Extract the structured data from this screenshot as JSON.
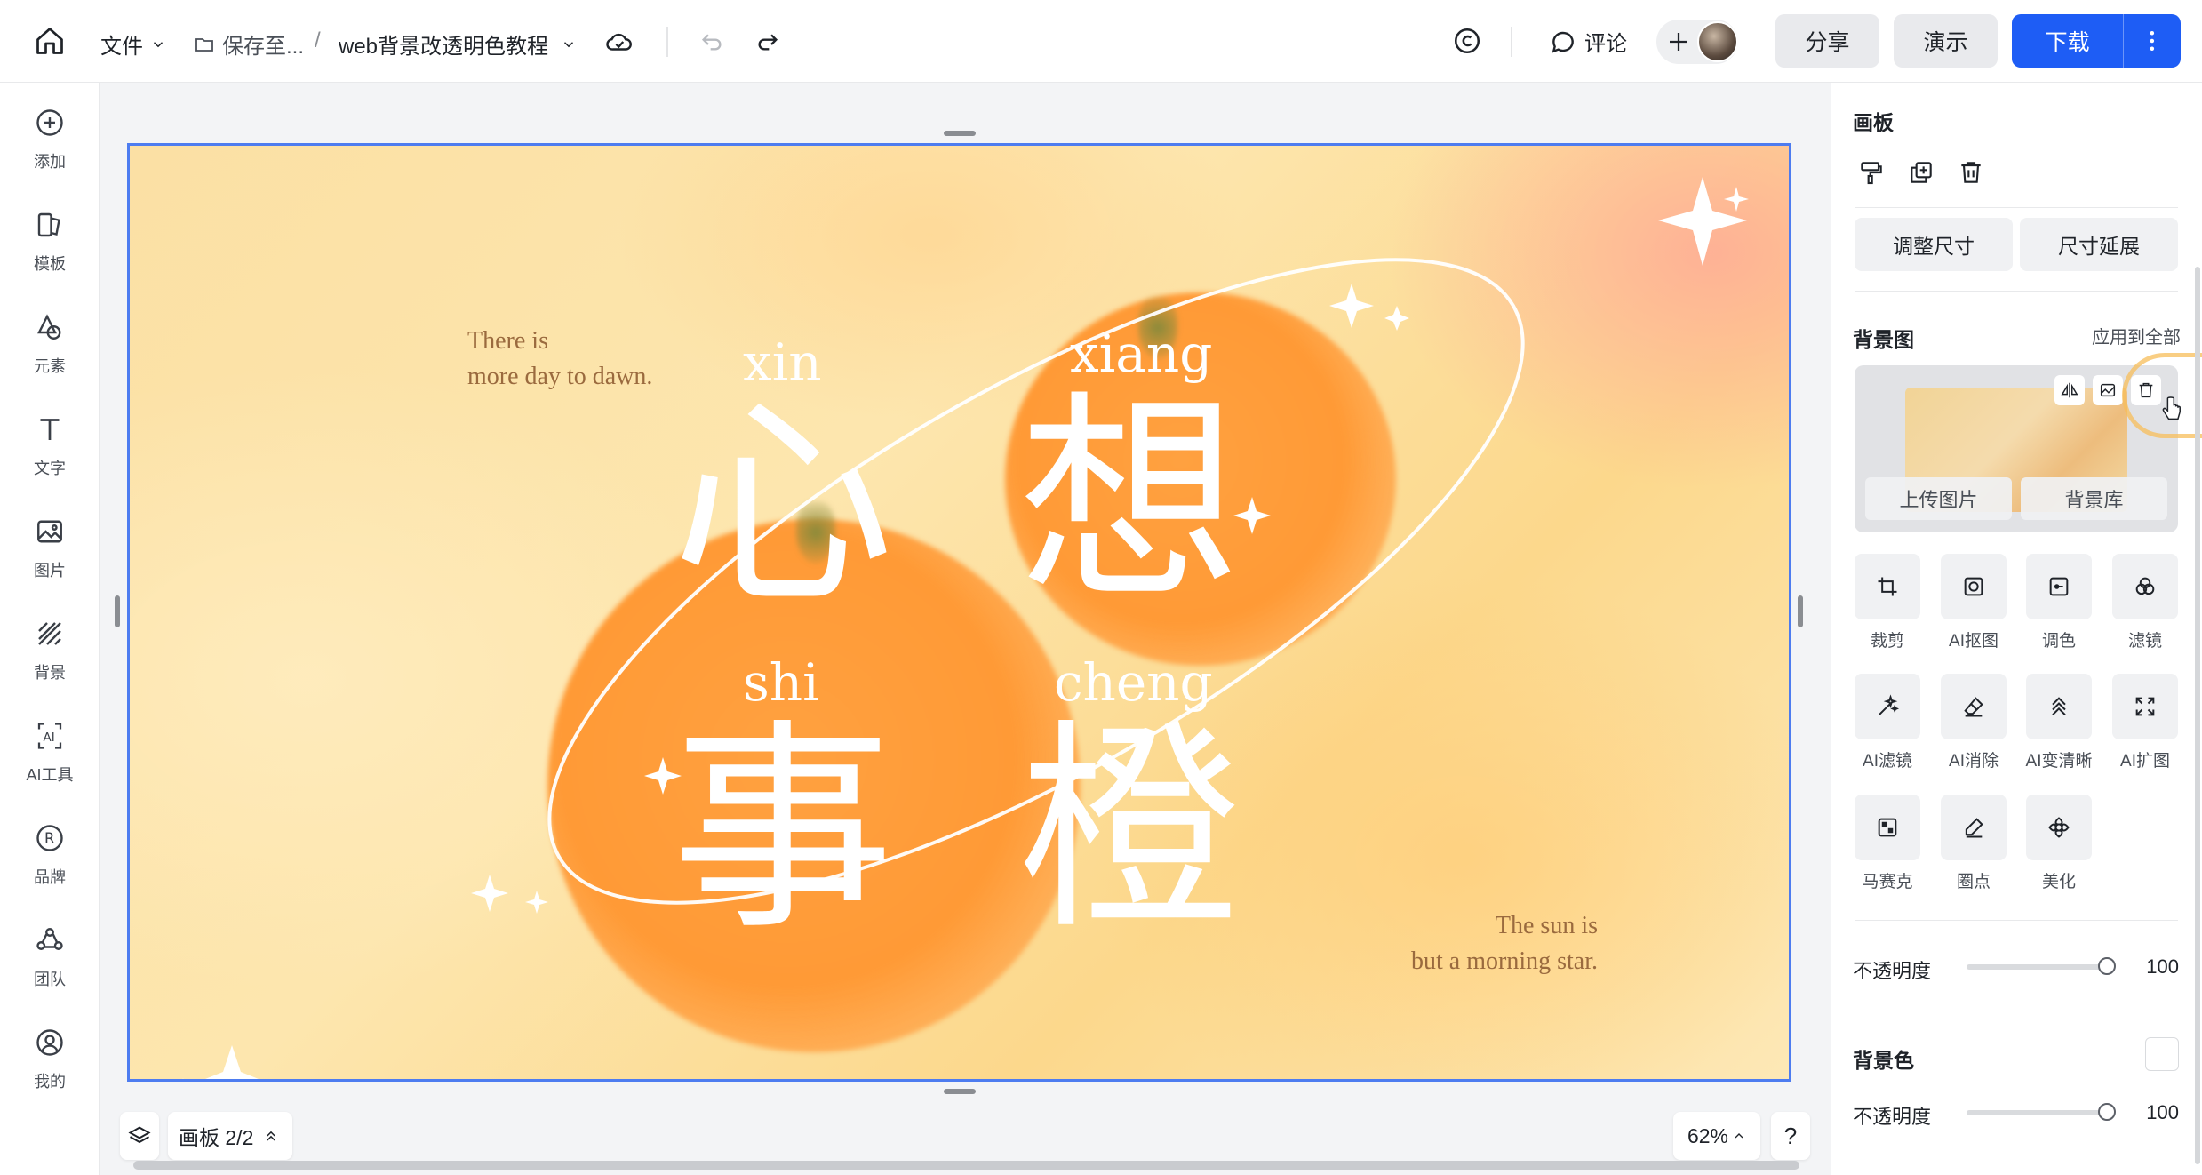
{
  "topbar": {
    "file_label": "文件",
    "save_path": "保存至...",
    "separator": "/",
    "doc_title": "web背景改透明色教程",
    "comment_label": "评论",
    "share_label": "分享",
    "present_label": "演示",
    "download_label": "下载"
  },
  "sidebar": {
    "items": [
      {
        "label": "添加",
        "icon": "plus-circle-icon"
      },
      {
        "label": "模板",
        "icon": "template-icon"
      },
      {
        "label": "元素",
        "icon": "shapes-icon"
      },
      {
        "label": "文字",
        "icon": "text-icon"
      },
      {
        "label": "图片",
        "icon": "image-icon"
      },
      {
        "label": "背景",
        "icon": "background-icon"
      },
      {
        "label": "AI工具",
        "icon": "ai-icon"
      },
      {
        "label": "品牌",
        "icon": "brand-icon"
      },
      {
        "label": "团队",
        "icon": "team-icon"
      },
      {
        "label": "我的",
        "icon": "user-icon"
      }
    ]
  },
  "canvas": {
    "quote_top": [
      "There is",
      "more day to dawn."
    ],
    "quote_bottom": [
      "The sun is",
      "but a morning star."
    ],
    "chars": [
      {
        "pinyin": "xin",
        "hanzi": "心"
      },
      {
        "pinyin": "xiang",
        "hanzi": "想"
      },
      {
        "pinyin": "shi",
        "hanzi": "事"
      },
      {
        "pinyin": "cheng",
        "hanzi": "橙"
      }
    ]
  },
  "bottombar": {
    "page_label": "画板 2/2",
    "zoom": "62%",
    "help": "?"
  },
  "panel": {
    "title": "画板",
    "resize_label": "调整尺寸",
    "extend_label": "尺寸延展",
    "bg_image_title": "背景图",
    "apply_all": "应用到全部",
    "upload_label": "上传图片",
    "library_label": "背景库",
    "tools": [
      {
        "label": "裁剪",
        "icon": "crop-icon"
      },
      {
        "label": "AI抠图",
        "icon": "ai-cutout-icon"
      },
      {
        "label": "调色",
        "icon": "adjust-color-icon"
      },
      {
        "label": "滤镜",
        "icon": "filter-icon"
      },
      {
        "label": "AI滤镜",
        "icon": "ai-filter-icon"
      },
      {
        "label": "AI消除",
        "icon": "ai-eraser-icon"
      },
      {
        "label": "AI变清晰",
        "icon": "ai-sharpen-icon"
      },
      {
        "label": "AI扩图",
        "icon": "ai-expand-icon"
      },
      {
        "label": "马赛克",
        "icon": "mosaic-icon"
      },
      {
        "label": "圈点",
        "icon": "mark-icon"
      },
      {
        "label": "美化",
        "icon": "beautify-icon"
      }
    ],
    "opacity_label": "不透明度",
    "opacity_value": "100",
    "opacity_level": 100,
    "bg_color_title": "背景色",
    "bg_color_value": "#ffffff",
    "bg_opacity_label": "不透明度",
    "bg_opacity_value": "100",
    "bg_opacity_level": 100
  }
}
